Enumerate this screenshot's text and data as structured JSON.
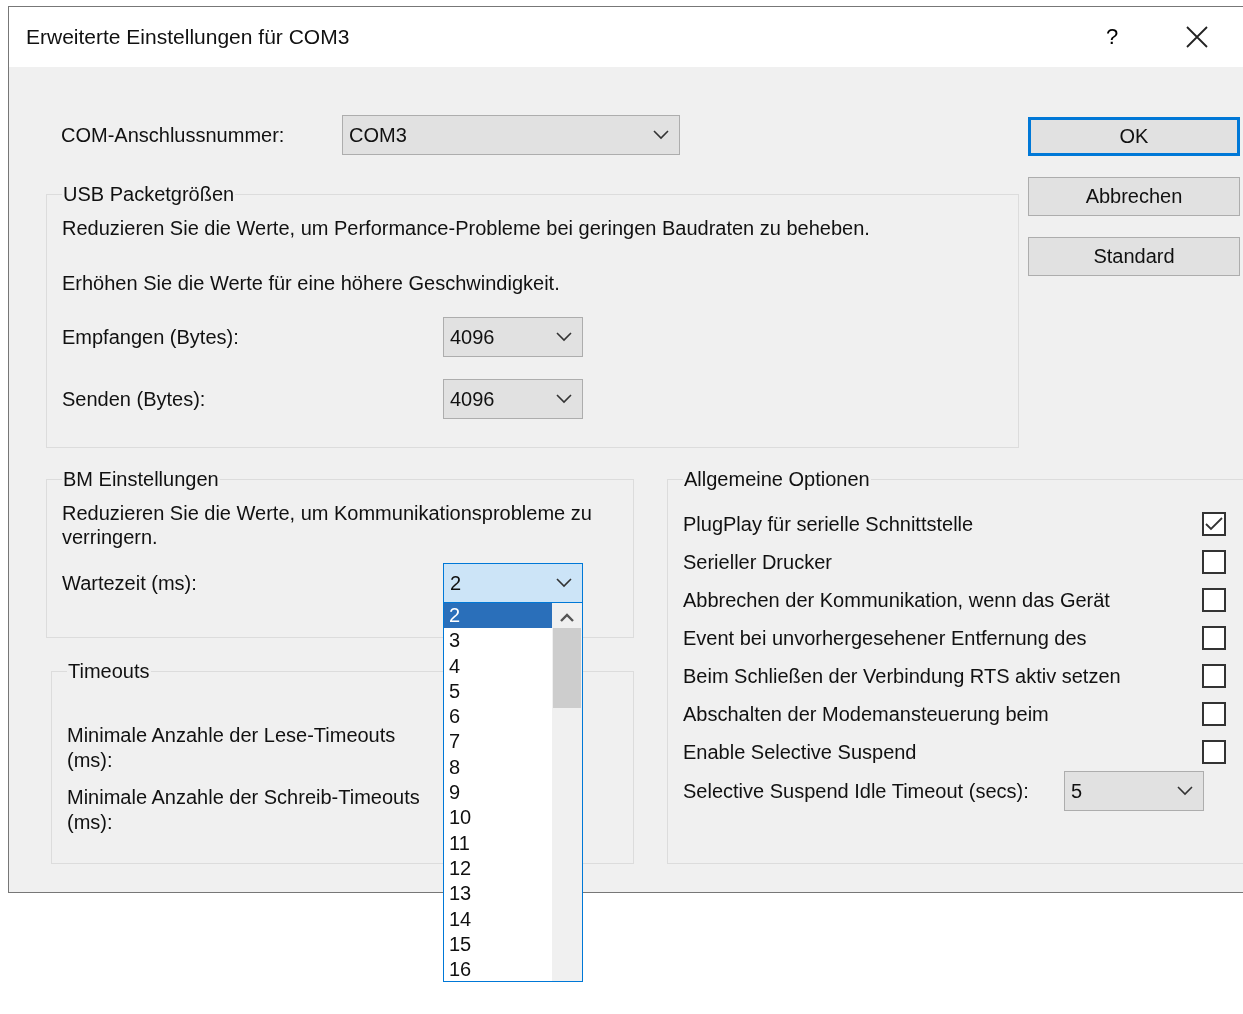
{
  "window": {
    "title": "Erweiterte Einstellungen für COM3",
    "help": "?"
  },
  "com_port": {
    "label": "COM-Anschlussnummer:",
    "value": "COM3"
  },
  "buttons": [
    {
      "label": "OK",
      "default": true
    },
    {
      "label": "Abbrechen",
      "default": false
    },
    {
      "label": "Standard",
      "default": false
    }
  ],
  "usb_group": {
    "title": "USB Packetgrößen",
    "notes": [
      "Reduzieren Sie die Werte, um Performance-Probleme bei geringen Baudraten zu beheben.",
      "Erhöhen Sie die Werte für eine höhere Geschwindigkeit."
    ],
    "fields": [
      {
        "label": "Empfangen (Bytes):",
        "value": "4096"
      },
      {
        "label": "Senden (Bytes):",
        "value": "4096"
      }
    ]
  },
  "bm_group": {
    "title": "BM Einstellungen",
    "note": "Reduzieren Sie die Werte, um Kommunikationsprobleme zu verringern.",
    "field": {
      "label": "Wartezeit (ms):",
      "value": "2",
      "open": true,
      "options": [
        {
          "label": "2",
          "selected": true
        },
        {
          "label": "3",
          "selected": false
        },
        {
          "label": "4",
          "selected": false
        },
        {
          "label": "5",
          "selected": false
        },
        {
          "label": "6",
          "selected": false
        },
        {
          "label": "7",
          "selected": false
        },
        {
          "label": "8",
          "selected": false
        },
        {
          "label": "9",
          "selected": false
        },
        {
          "label": "10",
          "selected": false
        },
        {
          "label": "11",
          "selected": false
        },
        {
          "label": "12",
          "selected": false
        },
        {
          "label": "13",
          "selected": false
        },
        {
          "label": "14",
          "selected": false
        },
        {
          "label": "15",
          "selected": false
        },
        {
          "label": "16",
          "selected": false
        }
      ]
    }
  },
  "timeouts_group": {
    "title": "Timeouts",
    "fields": [
      {
        "label": "Minimale Anzahle der Lese-Timeouts (ms):"
      },
      {
        "label": "Minimale Anzahle der Schreib-Timeouts (ms):"
      }
    ]
  },
  "general_group": {
    "title": "Allgemeine Optionen",
    "options": [
      {
        "label": "PlugPlay für serielle Schnittstelle",
        "checked": true
      },
      {
        "label": "Serieller Drucker",
        "checked": false
      },
      {
        "label": "Abbrechen der Kommunikation, wenn das Gerät",
        "checked": false
      },
      {
        "label": "Event bei unvorhergesehener Entfernung des",
        "checked": false
      },
      {
        "label": "Beim Schließen der Verbindung RTS aktiv setzen",
        "checked": false
      },
      {
        "label": "Abschalten der Modemansteuerung beim",
        "checked": false
      },
      {
        "label": "Enable Selective Suspend",
        "checked": false
      }
    ],
    "idle_timeout": {
      "label": "Selective Suspend Idle Timeout (secs):",
      "value": "5"
    }
  }
}
